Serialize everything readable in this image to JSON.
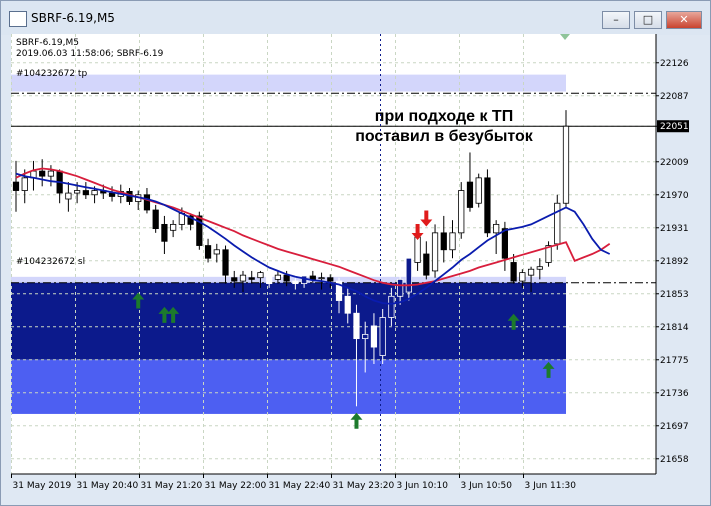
{
  "window": {
    "title": "SBRF-6.19,M5",
    "min_icon": "minimize-icon",
    "max_icon": "maximize-icon",
    "close_icon": "close-icon"
  },
  "chart_header": {
    "line1": "SBRF-6.19,M5",
    "line2": "2019.06.03 11:58:06; SBRF-6.19",
    "tp_label": "#104232672 tp",
    "sl_label": "#104232672 sl"
  },
  "annotation": {
    "line1": "при подходе к ТП",
    "line2": "поставил в безубыток"
  },
  "colors": {
    "background": "#ffffff",
    "grid": "#c9d6c3",
    "candle": "#000000",
    "ma_fast": "#0a1cae",
    "ma_slow": "#d81e3c",
    "zone_dark": "#0c1a8c",
    "zone_mid": "#4d5ff2",
    "zone_light": "#d3d6fb",
    "arrow_up": "#1c7a2c",
    "arrow_down": "#e01b1b"
  },
  "chart_data": {
    "type": "candlestick",
    "title": "SBRF-6.19,M5",
    "ylim": [
      21640,
      22160
    ],
    "y_ticks": [
      "22126",
      "22087",
      "22051",
      "22009",
      "21970",
      "21931",
      "21892",
      "21853",
      "21814",
      "21775",
      "21736",
      "21697",
      "21658"
    ],
    "x_ticks": [
      "31 May 2019",
      "31 May 20:40",
      "31 May 21:20",
      "31 May 22:00",
      "31 May 22:40",
      "31 May 23:20",
      "3 Jun 10:10",
      "3 Jun 10:50",
      "3 Jun 11:30"
    ],
    "current_price": "22051",
    "tp_level": 22090,
    "sl_level": 21866,
    "candles": [
      {
        "o": 21985,
        "h": 22010,
        "l": 21950,
        "c": 21975
      },
      {
        "o": 21975,
        "h": 22000,
        "l": 21960,
        "c": 21990
      },
      {
        "o": 21990,
        "h": 22010,
        "l": 21975,
        "c": 21998
      },
      {
        "o": 21998,
        "h": 22012,
        "l": 21980,
        "c": 21992
      },
      {
        "o": 21992,
        "h": 22005,
        "l": 21980,
        "c": 21998
      },
      {
        "o": 21998,
        "h": 22000,
        "l": 21960,
        "c": 21972
      },
      {
        "o": 21965,
        "h": 21985,
        "l": 21950,
        "c": 21972
      },
      {
        "o": 21972,
        "h": 21985,
        "l": 21960,
        "c": 21975
      },
      {
        "o": 21975,
        "h": 21985,
        "l": 21965,
        "c": 21970
      },
      {
        "o": 21970,
        "h": 21980,
        "l": 21960,
        "c": 21975
      },
      {
        "o": 21975,
        "h": 21982,
        "l": 21965,
        "c": 21972
      },
      {
        "o": 21972,
        "h": 21980,
        "l": 21962,
        "c": 21968
      },
      {
        "o": 21968,
        "h": 21982,
        "l": 21960,
        "c": 21974
      },
      {
        "o": 21974,
        "h": 21978,
        "l": 21958,
        "c": 21962
      },
      {
        "o": 21962,
        "h": 21975,
        "l": 21952,
        "c": 21970
      },
      {
        "o": 21970,
        "h": 21978,
        "l": 21948,
        "c": 21952
      },
      {
        "o": 21952,
        "h": 21958,
        "l": 21925,
        "c": 21930
      },
      {
        "o": 21935,
        "h": 21945,
        "l": 21900,
        "c": 21915
      },
      {
        "o": 21928,
        "h": 21940,
        "l": 21920,
        "c": 21935
      },
      {
        "o": 21935,
        "h": 21955,
        "l": 21928,
        "c": 21948
      },
      {
        "o": 21945,
        "h": 21948,
        "l": 21928,
        "c": 21935
      },
      {
        "o": 21945,
        "h": 21950,
        "l": 21905,
        "c": 21910
      },
      {
        "o": 21910,
        "h": 21918,
        "l": 21890,
        "c": 21895
      },
      {
        "o": 21900,
        "h": 21912,
        "l": 21890,
        "c": 21905
      },
      {
        "o": 21905,
        "h": 21910,
        "l": 21865,
        "c": 21875
      },
      {
        "o": 21872,
        "h": 21880,
        "l": 21860,
        "c": 21868
      },
      {
        "o": 21868,
        "h": 21880,
        "l": 21855,
        "c": 21875
      },
      {
        "o": 21872,
        "h": 21880,
        "l": 21865,
        "c": 21870
      },
      {
        "o": 21872,
        "h": 21880,
        "l": 21860,
        "c": 21878
      },
      {
        "o": 21878,
        "h": 21882,
        "l": 21860,
        "c": 21865
      },
      {
        "o": 21870,
        "h": 21880,
        "l": 21865,
        "c": 21875
      },
      {
        "o": 21875,
        "h": 21880,
        "l": 21862,
        "c": 21868
      },
      {
        "o": 21868,
        "h": 21876,
        "l": 21858,
        "c": 21865
      },
      {
        "o": 21865,
        "h": 21880,
        "l": 21860,
        "c": 21874
      },
      {
        "o": 21874,
        "h": 21880,
        "l": 21866,
        "c": 21870
      },
      {
        "o": 21872,
        "h": 21878,
        "l": 21858,
        "c": 21872
      },
      {
        "o": 21872,
        "h": 21876,
        "l": 21860,
        "c": 21868
      },
      {
        "o": 21868,
        "h": 21872,
        "l": 21830,
        "c": 21845
      },
      {
        "o": 21850,
        "h": 21860,
        "l": 21818,
        "c": 21830
      },
      {
        "o": 21830,
        "h": 21840,
        "l": 21720,
        "c": 21800
      },
      {
        "o": 21800,
        "h": 21820,
        "l": 21760,
        "c": 21805
      },
      {
        "o": 21815,
        "h": 21830,
        "l": 21770,
        "c": 21790
      },
      {
        "o": 21780,
        "h": 21835,
        "l": 21770,
        "c": 21825
      },
      {
        "o": 21825,
        "h": 21860,
        "l": 21815,
        "c": 21850
      },
      {
        "o": 21850,
        "h": 21875,
        "l": 21840,
        "c": 21870
      },
      {
        "o": 21855,
        "h": 21900,
        "l": 21845,
        "c": 21895
      },
      {
        "o": 21890,
        "h": 21930,
        "l": 21880,
        "c": 21920
      },
      {
        "o": 21900,
        "h": 21915,
        "l": 21870,
        "c": 21875
      },
      {
        "o": 21880,
        "h": 21935,
        "l": 21872,
        "c": 21925
      },
      {
        "o": 21925,
        "h": 21945,
        "l": 21890,
        "c": 21905
      },
      {
        "o": 21905,
        "h": 21940,
        "l": 21895,
        "c": 21925
      },
      {
        "o": 21925,
        "h": 21985,
        "l": 21918,
        "c": 21975
      },
      {
        "o": 21985,
        "h": 22020,
        "l": 21950,
        "c": 21955
      },
      {
        "o": 21960,
        "h": 21995,
        "l": 21955,
        "c": 21990
      },
      {
        "o": 21990,
        "h": 22000,
        "l": 21920,
        "c": 21925
      },
      {
        "o": 21925,
        "h": 21940,
        "l": 21900,
        "c": 21935
      },
      {
        "o": 21930,
        "h": 21938,
        "l": 21880,
        "c": 21895
      },
      {
        "o": 21890,
        "h": 21900,
        "l": 21865,
        "c": 21868
      },
      {
        "o": 21868,
        "h": 21882,
        "l": 21860,
        "c": 21878
      },
      {
        "o": 21875,
        "h": 21885,
        "l": 21855,
        "c": 21882
      },
      {
        "o": 21882,
        "h": 21895,
        "l": 21870,
        "c": 21885
      },
      {
        "o": 21890,
        "h": 21915,
        "l": 21885,
        "c": 21910
      },
      {
        "o": 21912,
        "h": 21970,
        "l": 21905,
        "c": 21960
      },
      {
        "o": 21960,
        "h": 22070,
        "l": 21955,
        "c": 22051
      }
    ],
    "ma_fast": [
      21995,
      21992,
      21990,
      21988,
      21986,
      21985,
      21983,
      21981,
      21979,
      21977,
      21975,
      21973,
      21971,
      21969,
      21967,
      21965,
      21962,
      21958,
      21953,
      21948,
      21943,
      21938,
      21932,
      21925,
      21918,
      21910,
      21903,
      21896,
      21890,
      21884,
      21880,
      21876,
      21873,
      21871,
      21869,
      21868,
      21866,
      21864,
      21860,
      21856,
      21850,
      21845,
      21842,
      21841,
      21843,
      21847,
      21853,
      21860,
      21868,
      21876,
      21884,
      21893,
      21900,
      21908,
      21916,
      21922,
      21928,
      21930,
      21932,
      21935,
      21940,
      21945,
      21950,
      21955
    ],
    "ma_slow": [
      21990,
      21995,
      21999,
      22001,
      22000,
      21998,
      21995,
      21992,
      21988,
      21984,
      21980,
      21976,
      21973,
      21970,
      21967,
      21964,
      21961,
      21958,
      21955,
      21951,
      21947,
      21943,
      21939,
      21935,
      21931,
      21927,
      21922,
      21918,
      21914,
      21910,
      21906,
      21903,
      21900,
      21897,
      21894,
      21891,
      21888,
      21885,
      21881,
      21877,
      21873,
      21869,
      21866,
      21864,
      21863,
      21863,
      21864,
      21866,
      21868,
      21871,
      21874,
      21877,
      21880,
      21884,
      21887,
      21890,
      21893,
      21896,
      21899,
      21902,
      21905,
      21908,
      21911,
      21914
    ],
    "ma_fast_tail": [
      21950,
      21935,
      21918,
      21905,
      21900
    ],
    "ma_slow_tail": [
      21892,
      21896,
      21900,
      21905,
      21912
    ],
    "buy_arrows": [
      {
        "i": 14,
        "y": 21845
      },
      {
        "i": 17,
        "y": 21828
      },
      {
        "i": 18,
        "y": 21828
      },
      {
        "i": 39,
        "y": 21703
      },
      {
        "i": 57,
        "y": 21820
      },
      {
        "i": 61,
        "y": 21763
      }
    ],
    "sell_arrows": [
      {
        "i": 46,
        "y": 21926
      },
      {
        "i": 47,
        "y": 21942
      }
    ],
    "zones": [
      {
        "from": 21866,
        "to": 21873,
        "level": "light"
      },
      {
        "from": 21775,
        "to": 21866,
        "level": "dark"
      },
      {
        "from": 21711,
        "to": 21775,
        "level": "mid"
      },
      {
        "from": 22092,
        "to": 22112,
        "level": "light"
      }
    ]
  }
}
